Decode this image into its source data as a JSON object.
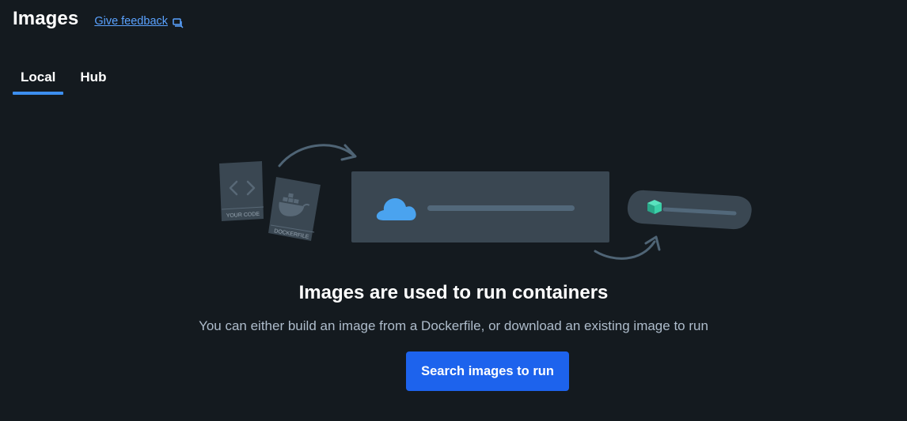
{
  "header": {
    "title": "Images",
    "feedback_label": "Give feedback",
    "feedback_icon": "chat-bubble-icon"
  },
  "tabs": [
    {
      "label": "Local",
      "active": true
    },
    {
      "label": "Hub",
      "active": false
    }
  ],
  "illustration": {
    "code_card_label": "YOUR CODE",
    "dockerfile_card_label": "DOCKERFILE",
    "icons": [
      "code-brackets-icon",
      "docker-whale-icon",
      "cloud-icon",
      "container-cube-icon"
    ]
  },
  "empty_state": {
    "title": "Images are used to run containers",
    "subtitle": "You can either build an image from a Dockerfile, or download an existing image to run",
    "button_label": "Search images to run"
  },
  "colors": {
    "background": "#141a1f",
    "accent": "#3d8ff0",
    "button": "#1d63ed",
    "link": "#5aa2ff",
    "cloud": "#4aa3ef",
    "cube": "#3ad0a8"
  }
}
